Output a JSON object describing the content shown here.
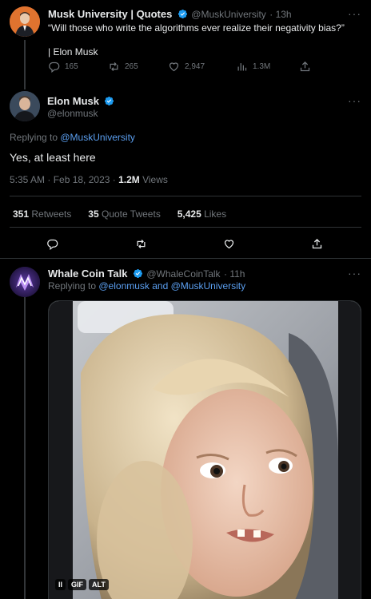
{
  "tweet1": {
    "name": "Musk University | Quotes",
    "handle": "@MuskUniversity",
    "time": "· 13h",
    "text": "“Will those who write the algorithms ever realize their negativity bias?”",
    "attribution": "| Elon Musk",
    "replies": "165",
    "retweets": "265",
    "likes": "2,947",
    "views": "1.3M"
  },
  "tweet2": {
    "name": "Elon Musk",
    "handle": "@elonmusk",
    "replying_prefix": "Replying to ",
    "replying_to": "@MuskUniversity",
    "text": "Yes, at least here",
    "timestamp": "5:35 AM · Feb 18, 2023 · ",
    "views_count": "1.2M",
    "views_label": " Views",
    "retweets_count": "351",
    "retweets_label": " Retweets",
    "quotes_count": "35",
    "quotes_label": " Quote Tweets",
    "likes_count": "5,425",
    "likes_label": " Likes"
  },
  "tweet3": {
    "name": "Whale Coin Talk",
    "handle": "@WhaleCoinTalk",
    "time": "· 11h",
    "replying_prefix": "Replying to ",
    "replying_to": "@elonmusk and @MuskUniversity",
    "media_badges": [
      "II",
      "GIF",
      "ALT"
    ]
  },
  "more_label": "···",
  "colors": {
    "accent": "#1d9bf0",
    "link": "#5b9ff0",
    "muted": "#71767b",
    "background": "#000000"
  }
}
